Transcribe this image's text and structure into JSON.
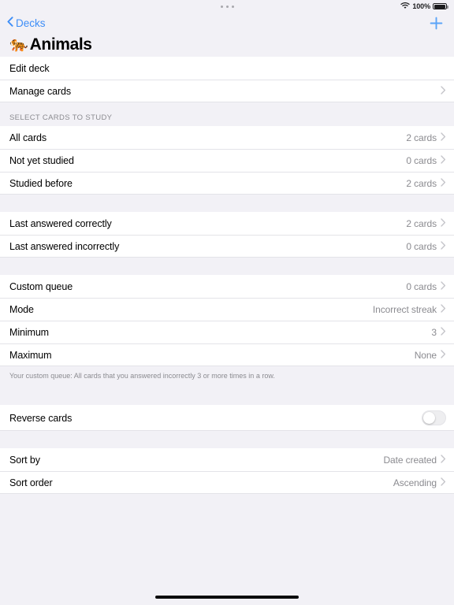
{
  "status_bar": {
    "multitask_dots": "multitasking-handle",
    "wifi_icon": "wifi-icon",
    "battery_percent": "100%",
    "battery_icon": "battery-full-icon"
  },
  "nav": {
    "back_label": "Decks",
    "back_icon": "chevron-left-icon",
    "add_icon": "plus-icon"
  },
  "header": {
    "emoji": "🐅",
    "title": "Animals"
  },
  "sections": [
    {
      "header": "",
      "footer": "",
      "rows": [
        {
          "label": "Edit deck",
          "value": "",
          "chevron": false,
          "type": "link"
        },
        {
          "label": "Manage cards",
          "value": "",
          "chevron": true,
          "type": "link"
        }
      ]
    },
    {
      "header": "SELECT CARDS TO STUDY",
      "footer": "",
      "rows": [
        {
          "label": "All cards",
          "value": "2 cards",
          "chevron": true,
          "type": "link"
        },
        {
          "label": "Not yet studied",
          "value": "0 cards",
          "chevron": true,
          "type": "link"
        },
        {
          "label": "Studied before",
          "value": "2 cards",
          "chevron": true,
          "type": "link"
        }
      ]
    },
    {
      "header": "",
      "footer": "",
      "rows": [
        {
          "label": "Last answered correctly",
          "value": "2 cards",
          "chevron": true,
          "type": "link"
        },
        {
          "label": "Last answered incorrectly",
          "value": "0 cards",
          "chevron": true,
          "type": "link"
        }
      ]
    },
    {
      "header": "",
      "footer": "Your custom queue: All cards that you answered incorrectly 3 or more times in a row.",
      "rows": [
        {
          "label": "Custom queue",
          "value": "0 cards",
          "chevron": true,
          "type": "link"
        },
        {
          "label": "Mode",
          "value": "Incorrect streak",
          "chevron": true,
          "type": "link"
        },
        {
          "label": "Minimum",
          "value": "3",
          "chevron": true,
          "type": "link"
        },
        {
          "label": "Maximum",
          "value": "None",
          "chevron": true,
          "type": "link"
        }
      ]
    },
    {
      "header": "",
      "footer": "",
      "rows": [
        {
          "label": "Reverse cards",
          "value": "",
          "chevron": false,
          "type": "toggle",
          "toggle_on": false
        }
      ]
    },
    {
      "header": "",
      "footer": "",
      "rows": [
        {
          "label": "Sort by",
          "value": "Date created",
          "chevron": true,
          "type": "link"
        },
        {
          "label": "Sort order",
          "value": "Ascending",
          "chevron": true,
          "type": "link"
        }
      ]
    }
  ],
  "colors": {
    "accent": "#3e8ef7",
    "background": "#f2f1f6",
    "surface": "#ffffff",
    "separator": "#e3e3e8",
    "secondary_text": "#8b8b90"
  },
  "home_indicator": "home-indicator"
}
